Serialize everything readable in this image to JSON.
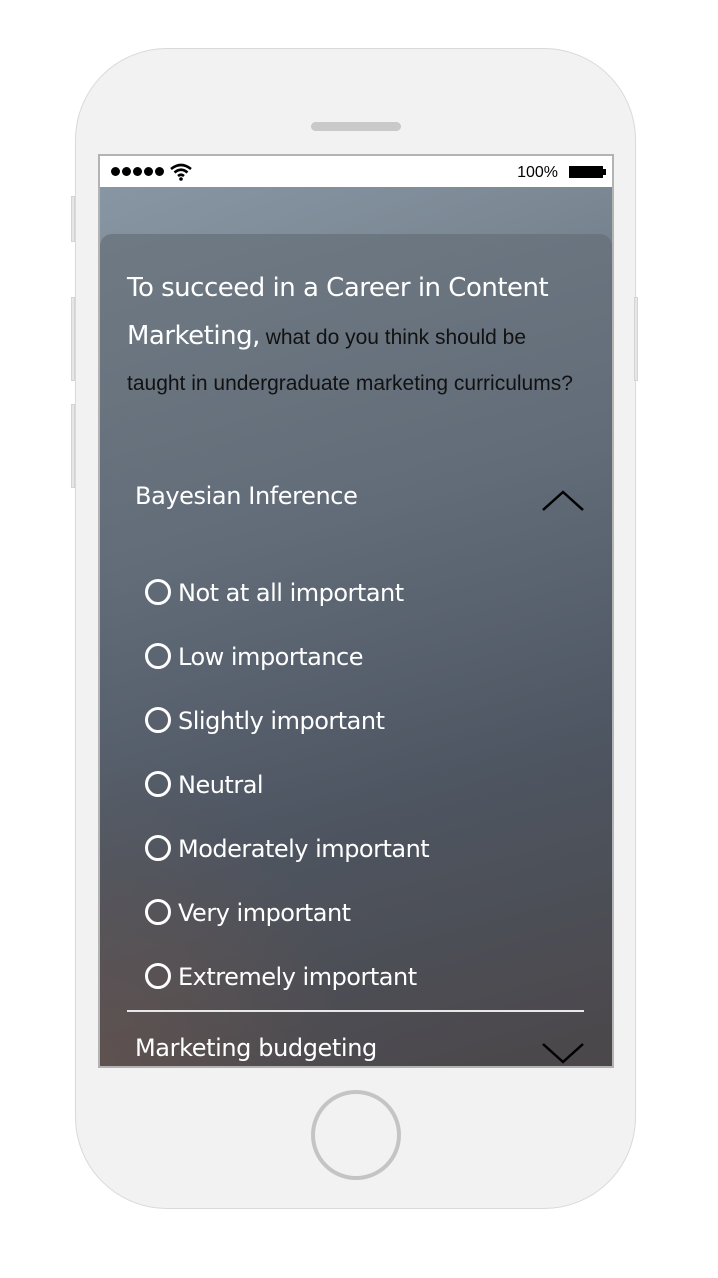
{
  "status_bar": {
    "battery_percent": "100%"
  },
  "question": {
    "main": "To succeed in a Career in Content Marketing,",
    "rest": " what do you think should be taught in undergraduate marketing curriculums?"
  },
  "accordion": [
    {
      "label": "Bayesian Inference",
      "expanded": true,
      "options": [
        "Not at all important",
        "Low importance",
        "Slightly important",
        "Neutral",
        "Moderately important",
        "Very important",
        "Extremely important"
      ]
    },
    {
      "label": "Marketing budgeting",
      "expanded": false
    }
  ],
  "colors": {
    "device_body": "#f2f2f2",
    "text_light": "#ffffff",
    "text_dark": "#111111"
  }
}
